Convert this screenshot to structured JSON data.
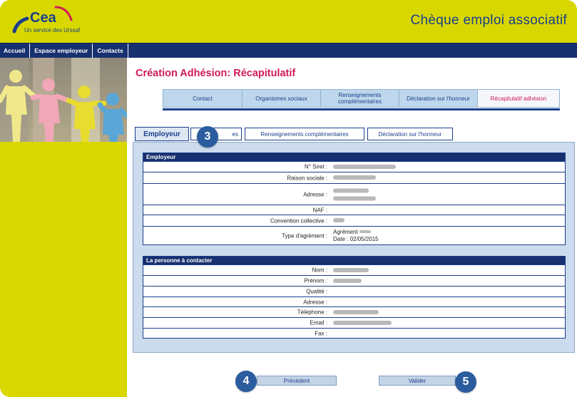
{
  "header": {
    "logo_text": "Cea",
    "logo_subtitle": "Un service des Urssaf",
    "app_title": "Chèque emploi associatif"
  },
  "nav": {
    "items": [
      {
        "label": "Accueil"
      },
      {
        "label": "Espace employeur"
      },
      {
        "label": "Contacts"
      }
    ]
  },
  "page": {
    "title": "Création Adhésion: Récapitulatif"
  },
  "steps": [
    {
      "label": "Contact"
    },
    {
      "label": "Organismes sociaux"
    },
    {
      "label": "Renseignements complémentaires"
    },
    {
      "label": "Déclaration sur l'honneur"
    },
    {
      "label": "Récapitulatif adhésion",
      "active": true
    }
  ],
  "tabs": [
    {
      "label": "Employeur",
      "active": true
    },
    {
      "label": "es"
    },
    {
      "label": "Renseignements complémentaires"
    },
    {
      "label": "Déclaration sur l'honneur"
    }
  ],
  "employeur": {
    "heading": "Employeur",
    "siret_label": "N° Siret :",
    "raison_label": "Raison sociale :",
    "adresse_label": "Adresse :",
    "naf_label": "NAF :",
    "convention_label": "Convention collective :",
    "agrement_label": "Type d'agrément :",
    "agrement_value_1": "Agrément",
    "agrement_value_2": "Date : 02/05/2015"
  },
  "contact": {
    "heading": "La personne à contacter",
    "nom_label": "Nom :",
    "prenom_label": "Prénom :",
    "qualite_label": "Qualité :",
    "adresse_label": "Adresse :",
    "telephone_label": "Téléphone :",
    "email_label": "Email :",
    "fax_label": "Fax :"
  },
  "buttons": {
    "previous": "Précédent",
    "validate": "Valider"
  },
  "markers": {
    "m3": "3",
    "m4": "4",
    "m5": "5"
  },
  "colors": {
    "header_bg": "#d8d800",
    "nav_bg": "#17306f",
    "title_accent": "#d11b55",
    "marker_bg": "#2b5c9e"
  }
}
